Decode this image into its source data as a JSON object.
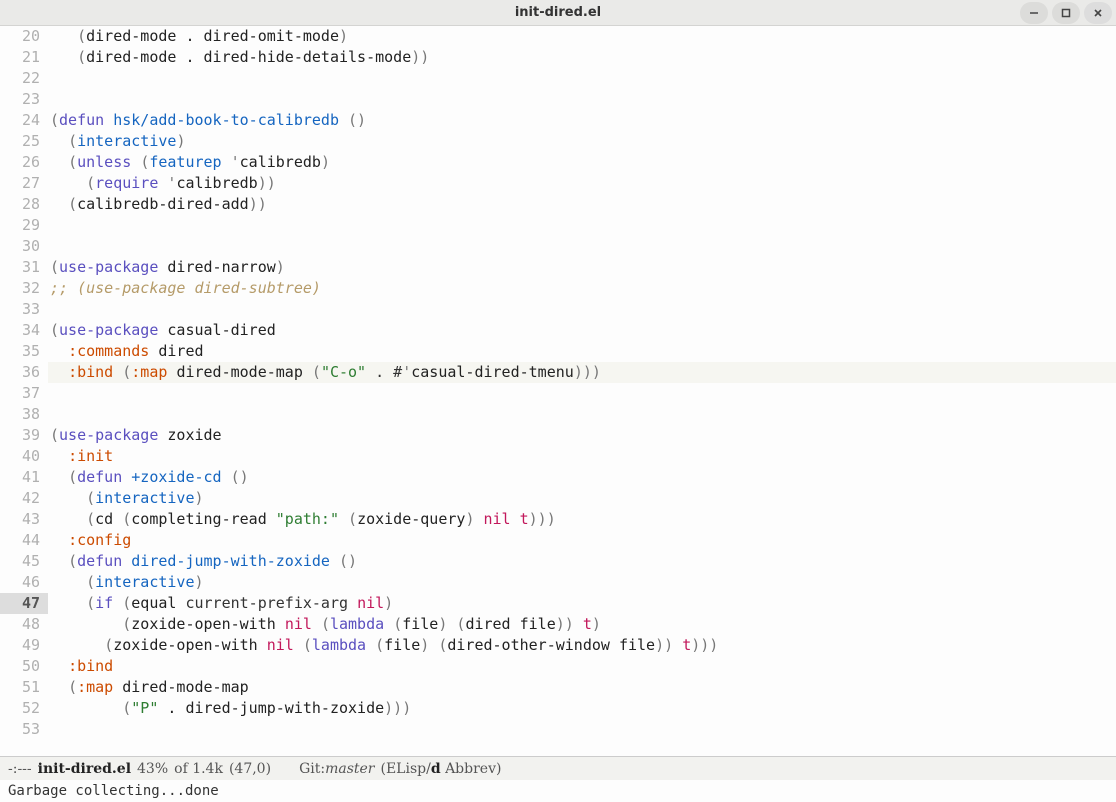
{
  "window": {
    "title": "init-dired.el"
  },
  "editor": {
    "current_line": 47,
    "lines": [
      {
        "n": 20,
        "tokens": [
          [
            "plain",
            "   "
          ],
          [
            "paren",
            "("
          ],
          [
            "sym",
            "dired-mode . dired-omit-mode"
          ],
          [
            "paren",
            ")"
          ]
        ]
      },
      {
        "n": 21,
        "tokens": [
          [
            "plain",
            "   "
          ],
          [
            "paren",
            "("
          ],
          [
            "sym",
            "dired-mode . dired-hide-details-mode"
          ],
          [
            "paren",
            "))"
          ]
        ]
      },
      {
        "n": 22,
        "tokens": []
      },
      {
        "n": 23,
        "tokens": []
      },
      {
        "n": 24,
        "tokens": [
          [
            "paren",
            "("
          ],
          [
            "kw",
            "defun"
          ],
          [
            "plain",
            " "
          ],
          [
            "fn",
            "hsk/add-book-to-calibredb"
          ],
          [
            "plain",
            " "
          ],
          [
            "paren",
            "()"
          ]
        ]
      },
      {
        "n": 25,
        "tokens": [
          [
            "plain",
            "  "
          ],
          [
            "paren",
            "("
          ],
          [
            "fn",
            "interactive"
          ],
          [
            "paren",
            ")"
          ]
        ]
      },
      {
        "n": 26,
        "tokens": [
          [
            "plain",
            "  "
          ],
          [
            "paren",
            "("
          ],
          [
            "kw",
            "unless"
          ],
          [
            "plain",
            " "
          ],
          [
            "paren",
            "("
          ],
          [
            "fn",
            "featurep"
          ],
          [
            "plain",
            " "
          ],
          [
            "quote",
            "'"
          ],
          [
            "sym",
            "calibredb"
          ],
          [
            "paren",
            ")"
          ]
        ]
      },
      {
        "n": 27,
        "tokens": [
          [
            "plain",
            "    "
          ],
          [
            "paren",
            "("
          ],
          [
            "kw",
            "require"
          ],
          [
            "plain",
            " "
          ],
          [
            "quote",
            "'"
          ],
          [
            "sym",
            "calibredb"
          ],
          [
            "paren",
            "))"
          ]
        ]
      },
      {
        "n": 28,
        "tokens": [
          [
            "plain",
            "  "
          ],
          [
            "paren",
            "("
          ],
          [
            "sym",
            "calibredb-dired-add"
          ],
          [
            "paren",
            "))"
          ]
        ]
      },
      {
        "n": 29,
        "tokens": []
      },
      {
        "n": 30,
        "tokens": []
      },
      {
        "n": 31,
        "tokens": [
          [
            "paren",
            "("
          ],
          [
            "kw",
            "use-package"
          ],
          [
            "plain",
            " "
          ],
          [
            "sym",
            "dired-narrow"
          ],
          [
            "paren",
            ")"
          ]
        ]
      },
      {
        "n": 32,
        "tokens": [
          [
            "comment",
            ";; (use-package dired-subtree)"
          ]
        ]
      },
      {
        "n": 33,
        "tokens": []
      },
      {
        "n": 34,
        "tokens": [
          [
            "paren",
            "("
          ],
          [
            "kw",
            "use-package"
          ],
          [
            "plain",
            " "
          ],
          [
            "sym",
            "casual-dired"
          ]
        ]
      },
      {
        "n": 35,
        "tokens": [
          [
            "plain",
            "  "
          ],
          [
            "key",
            ":commands"
          ],
          [
            "plain",
            " "
          ],
          [
            "sym",
            "dired"
          ]
        ]
      },
      {
        "n": 36,
        "hl": true,
        "tokens": [
          [
            "plain",
            "  "
          ],
          [
            "key",
            ":bind"
          ],
          [
            "plain",
            " "
          ],
          [
            "paren",
            "("
          ],
          [
            "key",
            ":map"
          ],
          [
            "plain",
            " "
          ],
          [
            "sym",
            "dired-mode-map"
          ],
          [
            "plain",
            " "
          ],
          [
            "paren",
            "("
          ],
          [
            "str",
            "\"C-o\""
          ],
          [
            "plain",
            " . #"
          ],
          [
            "quote",
            "'"
          ],
          [
            "sym",
            "casual-dired-tmenu"
          ],
          [
            "paren",
            ")))"
          ]
        ]
      },
      {
        "n": 37,
        "tokens": []
      },
      {
        "n": 38,
        "tokens": []
      },
      {
        "n": 39,
        "tokens": [
          [
            "paren",
            "("
          ],
          [
            "kw",
            "use-package"
          ],
          [
            "plain",
            " "
          ],
          [
            "sym",
            "zoxide"
          ]
        ]
      },
      {
        "n": 40,
        "tokens": [
          [
            "plain",
            "  "
          ],
          [
            "key",
            ":init"
          ]
        ]
      },
      {
        "n": 41,
        "tokens": [
          [
            "plain",
            "  "
          ],
          [
            "paren",
            "("
          ],
          [
            "kw",
            "defun"
          ],
          [
            "plain",
            " "
          ],
          [
            "fn",
            "+zoxide-cd"
          ],
          [
            "plain",
            " "
          ],
          [
            "paren",
            "()"
          ]
        ]
      },
      {
        "n": 42,
        "tokens": [
          [
            "plain",
            "    "
          ],
          [
            "paren",
            "("
          ],
          [
            "fn",
            "interactive"
          ],
          [
            "paren",
            ")"
          ]
        ]
      },
      {
        "n": 43,
        "tokens": [
          [
            "plain",
            "    "
          ],
          [
            "paren",
            "("
          ],
          [
            "sym",
            "cd"
          ],
          [
            "plain",
            " "
          ],
          [
            "paren",
            "("
          ],
          [
            "sym",
            "completing-read"
          ],
          [
            "plain",
            " "
          ],
          [
            "str",
            "\"path:\""
          ],
          [
            "plain",
            " "
          ],
          [
            "paren",
            "("
          ],
          [
            "sym",
            "zoxide-query"
          ],
          [
            "paren",
            ")"
          ],
          [
            "plain",
            " "
          ],
          [
            "const",
            "nil"
          ],
          [
            "plain",
            " "
          ],
          [
            "const",
            "t"
          ],
          [
            "paren",
            ")))"
          ]
        ]
      },
      {
        "n": 44,
        "tokens": [
          [
            "plain",
            "  "
          ],
          [
            "key",
            ":config"
          ]
        ]
      },
      {
        "n": 45,
        "tokens": [
          [
            "plain",
            "  "
          ],
          [
            "paren",
            "("
          ],
          [
            "kw",
            "defun"
          ],
          [
            "plain",
            " "
          ],
          [
            "fn",
            "dired-jump-with-zoxide"
          ],
          [
            "plain",
            " "
          ],
          [
            "paren",
            "()"
          ]
        ]
      },
      {
        "n": 46,
        "tokens": [
          [
            "plain",
            "    "
          ],
          [
            "paren",
            "("
          ],
          [
            "fn",
            "interactive"
          ],
          [
            "paren",
            ")"
          ]
        ]
      },
      {
        "n": 47,
        "tokens": [
          [
            "plain",
            "    "
          ],
          [
            "paren",
            "("
          ],
          [
            "kw",
            "if"
          ],
          [
            "plain",
            " "
          ],
          [
            "paren",
            "("
          ],
          [
            "sym",
            "equal"
          ],
          [
            "plain",
            " current-prefix-arg "
          ],
          [
            "const",
            "nil"
          ],
          [
            "paren",
            ")"
          ]
        ]
      },
      {
        "n": 48,
        "tokens": [
          [
            "plain",
            "        "
          ],
          [
            "paren",
            "("
          ],
          [
            "sym",
            "zoxide-open-with"
          ],
          [
            "plain",
            " "
          ],
          [
            "const",
            "nil"
          ],
          [
            "plain",
            " "
          ],
          [
            "paren",
            "("
          ],
          [
            "kw",
            "lambda"
          ],
          [
            "plain",
            " "
          ],
          [
            "paren",
            "("
          ],
          [
            "sym",
            "file"
          ],
          [
            "paren",
            ")"
          ],
          [
            "plain",
            " "
          ],
          [
            "paren",
            "("
          ],
          [
            "sym",
            "dired file"
          ],
          [
            "paren",
            "))"
          ],
          [
            "plain",
            " "
          ],
          [
            "const",
            "t"
          ],
          [
            "paren",
            ")"
          ]
        ]
      },
      {
        "n": 49,
        "tokens": [
          [
            "plain",
            "      "
          ],
          [
            "paren",
            "("
          ],
          [
            "sym",
            "zoxide-open-with"
          ],
          [
            "plain",
            " "
          ],
          [
            "const",
            "nil"
          ],
          [
            "plain",
            " "
          ],
          [
            "paren",
            "("
          ],
          [
            "kw",
            "lambda"
          ],
          [
            "plain",
            " "
          ],
          [
            "paren",
            "("
          ],
          [
            "sym",
            "file"
          ],
          [
            "paren",
            ")"
          ],
          [
            "plain",
            " "
          ],
          [
            "paren",
            "("
          ],
          [
            "sym",
            "dired-other-window file"
          ],
          [
            "paren",
            "))"
          ],
          [
            "plain",
            " "
          ],
          [
            "const",
            "t"
          ],
          [
            "paren",
            ")))"
          ]
        ]
      },
      {
        "n": 50,
        "tokens": [
          [
            "plain",
            "  "
          ],
          [
            "key",
            ":bind"
          ]
        ]
      },
      {
        "n": 51,
        "tokens": [
          [
            "plain",
            "  "
          ],
          [
            "paren",
            "("
          ],
          [
            "key",
            ":map"
          ],
          [
            "plain",
            " "
          ],
          [
            "sym",
            "dired-mode-map"
          ]
        ]
      },
      {
        "n": 52,
        "tokens": [
          [
            "plain",
            "        "
          ],
          [
            "paren",
            "("
          ],
          [
            "str",
            "\"P\""
          ],
          [
            "sym",
            " . dired-jump-with-zoxide"
          ],
          [
            "paren",
            ")))"
          ]
        ]
      },
      {
        "n": 53,
        "tokens": []
      }
    ]
  },
  "modeline": {
    "prefix": "-:---",
    "buffer": "init-dired.el",
    "percent": "43%",
    "size": "of 1.4k",
    "pos": "(47,0)",
    "vc_prefix": "Git:",
    "vc_branch": "master",
    "modes_open": "(ELisp",
    "modes_d": "d",
    "modes_rest": " Abbrev)"
  },
  "echo": {
    "message": "Garbage collecting...done"
  }
}
